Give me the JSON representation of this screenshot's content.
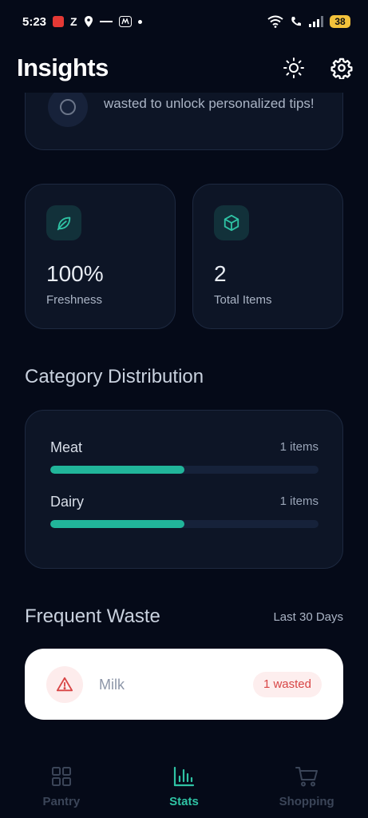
{
  "status_bar": {
    "time": "5:23",
    "z_label": "Z",
    "battery": "38"
  },
  "header": {
    "title": "Insights",
    "theme_icon": "sun-icon",
    "settings_icon": "gear-icon"
  },
  "tip": {
    "text": "wasted to unlock personalized tips!"
  },
  "stats": [
    {
      "value": "100%",
      "label": "Freshness",
      "icon": "leaf-icon"
    },
    {
      "value": "2",
      "label": "Total Items",
      "icon": "box-icon"
    }
  ],
  "category_distribution": {
    "title": "Category Distribution",
    "items": [
      {
        "name": "Meat",
        "count": "1 items",
        "fraction": 0.5
      },
      {
        "name": "Dairy",
        "count": "1 items",
        "fraction": 0.5
      }
    ]
  },
  "frequent_waste": {
    "title": "Frequent Waste",
    "period": "Last 30 Days",
    "items": [
      {
        "name": "Milk",
        "badge": "1 wasted",
        "icon": "warning-icon"
      }
    ]
  },
  "nav": {
    "items": [
      {
        "label": "Pantry",
        "icon": "grid-icon",
        "active": false
      },
      {
        "label": "Stats",
        "icon": "bar-chart-icon",
        "active": true
      },
      {
        "label": "Shopping",
        "icon": "cart-icon",
        "active": false
      }
    ]
  },
  "colors": {
    "background": "#050a18",
    "card": "#0d1526",
    "accent": "#21b59a",
    "danger": "#d84545"
  }
}
